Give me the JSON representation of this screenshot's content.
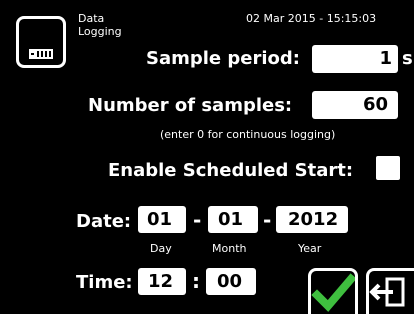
{
  "header": {
    "title_line1": "Data",
    "title_line2": "Logging",
    "datetime": "02 Mar 2015 - 15:15:03"
  },
  "sample_period": {
    "label": "Sample period:",
    "value": "1",
    "unit": "s"
  },
  "num_samples": {
    "label": "Number of samples:",
    "value": "60",
    "hint": "(enter 0 for continuous logging)"
  },
  "scheduled_start": {
    "label": "Enable Scheduled Start:",
    "checked": false
  },
  "date": {
    "label": "Date:",
    "day": "01",
    "month": "01",
    "year": "2012",
    "sep": "-",
    "day_label": "Day",
    "month_label": "Month",
    "year_label": "Year"
  },
  "time": {
    "label": "Time:",
    "hour": "12",
    "minute": "00",
    "sep": ":"
  },
  "icons": {
    "app": "data-logging-icon",
    "confirm": "checkmark-icon",
    "exit": "exit-icon"
  },
  "colors": {
    "confirm_green": "#3fbf3f"
  }
}
